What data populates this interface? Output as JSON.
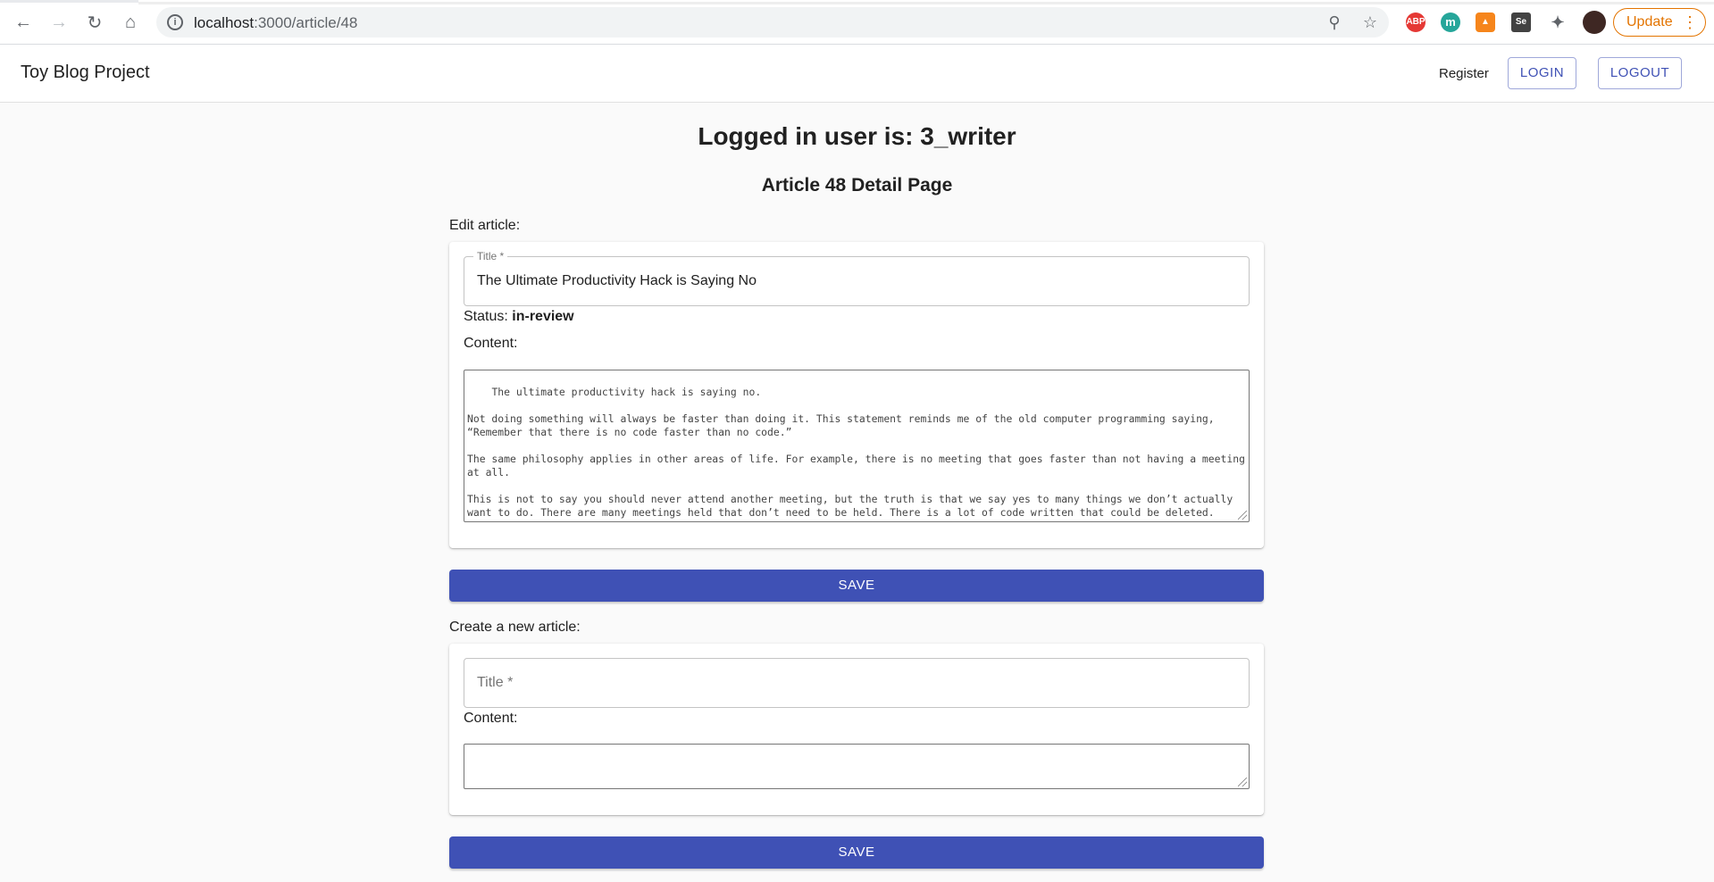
{
  "browser": {
    "url_host": "localhost",
    "url_path": ":3000/article/48",
    "update_label": "Update"
  },
  "appbar": {
    "brand": "Toy Blog Project",
    "register": "Register",
    "login": "LOGIN",
    "logout": "LOGOUT"
  },
  "page": {
    "logged_in": "Logged in user is: 3_writer",
    "detail_title": "Article 48 Detail Page"
  },
  "edit": {
    "section_label": "Edit article:",
    "title_legend": "Title *",
    "title_value": "The Ultimate Productivity Hack is Saying No",
    "status_label": "Status:",
    "status_value": "in-review",
    "content_label": "Content:",
    "content_value": "The ultimate productivity hack is saying no.\n\nNot doing something will always be faster than doing it. This statement reminds me of the old computer programming saying, “Remember that there is no code faster than no code.”\n\nThe same philosophy applies in other areas of life. For example, there is no meeting that goes faster than not having a meeting at all.\n\nThis is not to say you should never attend another meeting, but the truth is that we say yes to many things we don’t actually want to do. There are many meetings held that don’t need to be held. There is a lot of code written that could be deleted.",
    "save_label": "SAVE"
  },
  "create": {
    "section_label": "Create a new article:",
    "title_placeholder": "Title *",
    "content_label": "Content:",
    "content_value": "",
    "save_label": "SAVE"
  }
}
